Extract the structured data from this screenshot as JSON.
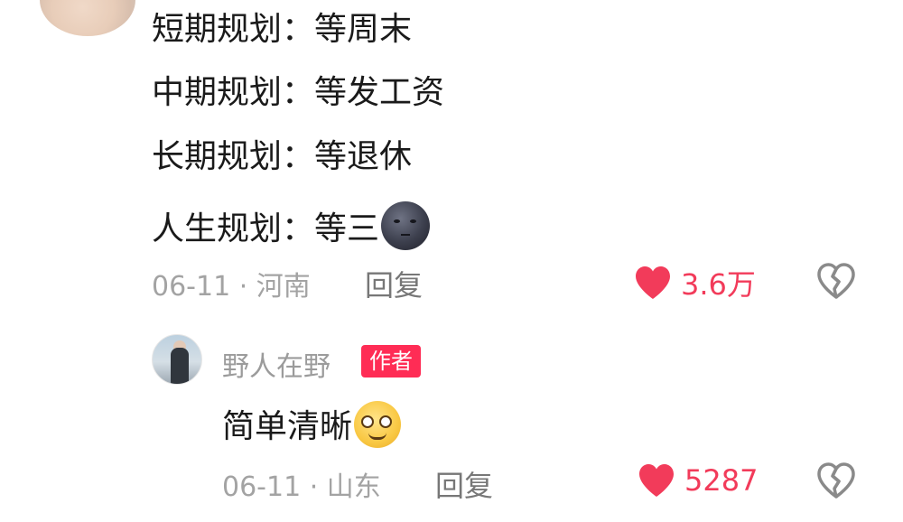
{
  "comment": {
    "lines": [
      "短期规划：等周末",
      "中期规划：等发工资",
      "长期规划：等退休",
      "人生规划：等三"
    ],
    "emoji": "new-moon-face-icon",
    "date_location": "06-11 · 河南",
    "reply_label": "回复",
    "like_count": "3.6万"
  },
  "reply": {
    "username": "野人在野",
    "author_badge": "作者",
    "text": "简单清晰",
    "emoji": "dizzy-face-icon",
    "date_location": "06-11 · 山东",
    "reply_label": "回复",
    "like_count": "5287"
  },
  "colors": {
    "like": "#f23b5a",
    "badge": "#ff2c55",
    "meta": "#a3a3a3"
  }
}
